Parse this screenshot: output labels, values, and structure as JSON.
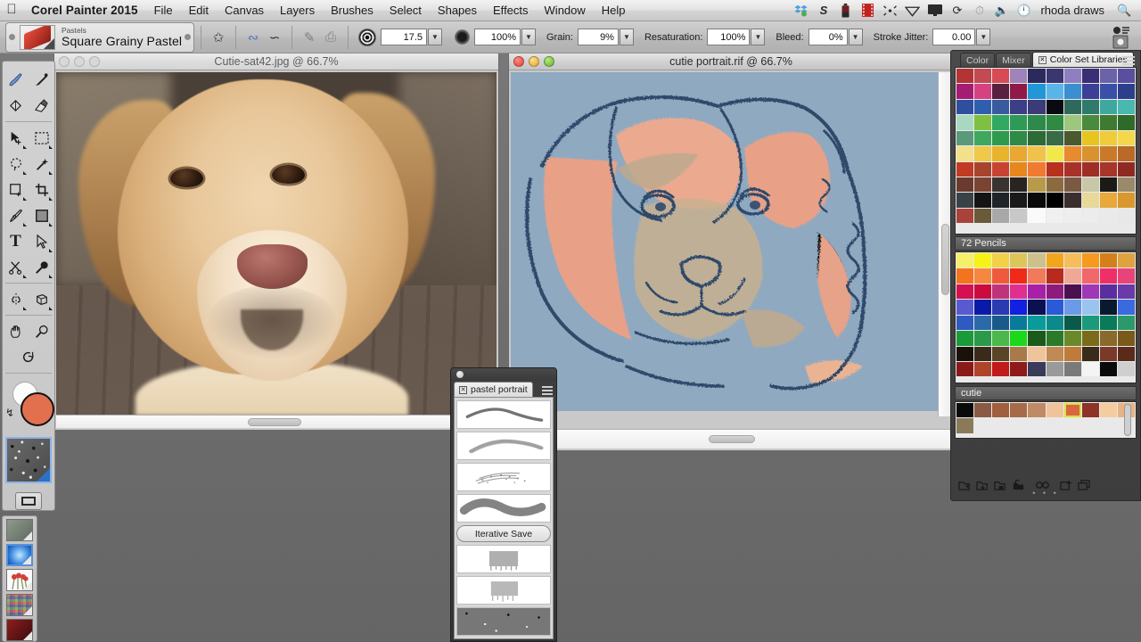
{
  "menubar": {
    "apple_icon": "apple-logo",
    "app_title": "Corel Painter 2015",
    "items": [
      "File",
      "Edit",
      "Canvas",
      "Layers",
      "Brushes",
      "Select",
      "Shapes",
      "Effects",
      "Window",
      "Help"
    ],
    "status_icons": [
      "dropbox-icon",
      "skitch-icon",
      "battery-icon",
      "screenflow-icon",
      "airplay-icon",
      "diamond-icon",
      "display-icon",
      "sync-icon",
      "timemachine-icon",
      "volume-icon",
      "clock-icon"
    ],
    "user_name": "rhoda draws",
    "search_icon": "search-icon"
  },
  "propbar": {
    "brush_category": "Pastels",
    "brush_name": "Square Grainy Pastel",
    "icons": [
      "brush-tracking-icon",
      "stroke-freehand-icon",
      "stroke-straight-icon",
      "brush-loading-icon",
      "brush-clone-icon"
    ],
    "size_icon": "brush-size-icon",
    "size_value": "17.5",
    "opacity_icon": "brush-opacity-icon",
    "opacity_value": "100%",
    "grain_label": "Grain:",
    "grain_value": "9%",
    "resaturation_label": "Resaturation:",
    "resaturation_value": "100%",
    "bleed_label": "Bleed:",
    "bleed_value": "0%",
    "jitter_label": "Stroke Jitter:",
    "jitter_value": "0.00",
    "right_icon": "brush-control-panel-icon"
  },
  "toolbox": {
    "tools": [
      {
        "name": "brush-tool",
        "glyph": "✎",
        "selected": true,
        "arrow": false
      },
      {
        "name": "dropper-tool",
        "glyph": "✒",
        "selected": false,
        "arrow": false
      },
      {
        "name": "paint-bucket-tool",
        "glyph": "◢",
        "selected": false,
        "arrow": false
      },
      {
        "name": "eraser-tool",
        "glyph": "▧",
        "selected": false,
        "arrow": false
      },
      {
        "name": "layer-adjuster-tool",
        "glyph": "➤",
        "selected": false,
        "arrow": true
      },
      {
        "name": "rectangular-selection-tool",
        "glyph": "⬚",
        "selected": false,
        "arrow": true
      },
      {
        "name": "lasso-tool",
        "glyph": "◌",
        "selected": false,
        "arrow": true
      },
      {
        "name": "magic-wand-tool",
        "glyph": "✦",
        "selected": false,
        "arrow": true
      },
      {
        "name": "crop-selection-tool",
        "glyph": "⬚",
        "selected": false,
        "arrow": true
      },
      {
        "name": "crop-tool",
        "glyph": "✛",
        "selected": false,
        "arrow": true
      },
      {
        "name": "pen-tool",
        "glyph": "✐",
        "selected": false,
        "arrow": true
      },
      {
        "name": "rectangular-shape-tool",
        "glyph": "■",
        "selected": false,
        "arrow": true
      },
      {
        "name": "text-tool",
        "glyph": "T",
        "selected": false,
        "arrow": false
      },
      {
        "name": "shape-selection-tool",
        "glyph": "➤",
        "selected": false,
        "arrow": true
      },
      {
        "name": "scissors-tool",
        "glyph": "✂",
        "selected": false,
        "arrow": true
      },
      {
        "name": "dropper-magnify-tool",
        "glyph": "⚲",
        "selected": false,
        "arrow": true
      },
      {
        "name": "mirror-painting-tool",
        "glyph": "⑂",
        "selected": false,
        "arrow": true
      },
      {
        "name": "perspective-grid-tool",
        "glyph": "▣",
        "selected": false,
        "arrow": true
      },
      {
        "name": "grabber-hand-tool",
        "glyph": "✋",
        "selected": false,
        "arrow": false
      },
      {
        "name": "magnifier-tool",
        "glyph": "⚲",
        "selected": false,
        "arrow": false
      },
      {
        "name": "rotate-page-tool",
        "glyph": "↻",
        "selected": false,
        "arrow": false
      }
    ],
    "paper_color": "#fdfdfd",
    "main_color": "#e2704f",
    "swap_icon": "swap-colors-icon",
    "paper_texture_name": "paper-texture-swatch",
    "screen_mode_icon": "screen-mode-icon"
  },
  "media_strip": {
    "items": [
      "paper-selector",
      "gradient-selector",
      "pattern-selector",
      "weave-selector",
      "nozzle-selector"
    ]
  },
  "documents": [
    {
      "id": "photo",
      "title": "Cutie-sat42.jpg @ 66.7%",
      "active": false,
      "traffic_lights": [
        "close-button",
        "minimize-button",
        "zoom-button"
      ],
      "zoom": "66.7%"
    },
    {
      "id": "painting",
      "title": "cutie portrait.rif @ 66.7%",
      "active": true,
      "traffic_lights": [
        "close-button",
        "minimize-button",
        "zoom-button"
      ],
      "zoom": "66.7%"
    }
  ],
  "float_palette": {
    "title": "pastel portrait",
    "close_icon": "close-icon",
    "menu_icon": "palette-menu-icon",
    "items": [
      {
        "name": "brush-stroke-thumbnail",
        "type": "stroke"
      },
      {
        "name": "brush-stroke-thumbnail",
        "type": "stroke"
      },
      {
        "name": "brush-stroke-thumbnail",
        "type": "stroke"
      },
      {
        "name": "brush-stroke-thumbnail",
        "type": "stroke"
      }
    ],
    "button_label": "Iterative Save",
    "items_after": [
      {
        "name": "brush-stroke-thumbnail",
        "type": "stroke"
      },
      {
        "name": "brush-stroke-thumbnail",
        "type": "stroke"
      },
      {
        "name": "paper-texture-thumbnail",
        "type": "grain"
      }
    ]
  },
  "color_panel": {
    "tabs": [
      {
        "label": "Color",
        "active": false,
        "closable": false
      },
      {
        "label": "Mixer",
        "active": false,
        "closable": false
      },
      {
        "label": "Color Set Libraries",
        "active": true,
        "closable": true
      }
    ],
    "menu_icon": "panel-menu-icon",
    "groups": [
      {
        "name": "painter-colors",
        "header": null,
        "columns": 10,
        "swatches": [
          "#b33434",
          "#c24a52",
          "#d84b54",
          "#9e84b8",
          "#2b2a5c",
          "#3b3570",
          "#8f7fc0",
          "#3a2f74",
          "#6b63a8",
          "#5a4e9e",
          "#a51d72",
          "#d6417f",
          "#5a2040",
          "#8e1a4a",
          "#2196d8",
          "#5ab4e8",
          "#3a8fd0",
          "#3c3f96",
          "#3a4fa8",
          "#2b3f8a",
          "#2f4f9e",
          "#2e5fae",
          "#3a5aa0",
          "#3a3f86",
          "#3c3a78",
          "#0a0a12",
          "#2e6a5c",
          "#2f7a6a",
          "#3ea8a0",
          "#49b8ae",
          "#a8d8c0",
          "#7ec042",
          "#32a862",
          "#2f9a58",
          "#2e8a4c",
          "#2f8a42",
          "#9ec77e",
          "#4a8a3e",
          "#3e7a32",
          "#2f6a2a",
          "#5a9a7a",
          "#3ea85e",
          "#2f9a4e",
          "#2e8a46",
          "#2c6a36",
          "#3a6a46",
          "#4a5a2e",
          "#e8c41e",
          "#f0cc3a",
          "#f5d84a",
          "#f2e08a",
          "#f0c84a",
          "#e8b42e",
          "#e8a832",
          "#f0c24a",
          "#f2e84a",
          "#e88a2e",
          "#d8922e",
          "#c87a2a",
          "#b86a26",
          "#c03a24",
          "#a8432e",
          "#c84432",
          "#e8861e",
          "#f07a32",
          "#b8301e",
          "#a8322a",
          "#9e2e26",
          "#a8352a",
          "#8e2a22",
          "#6a3a2e",
          "#7a4432",
          "#3a3430",
          "#2a2420",
          "#b89a4a",
          "#8a6a3e",
          "#7a5a42",
          "#c8c8a8",
          "#1a1a16",
          "#9a8a6a",
          "#3a4248",
          "#141414",
          "#1e2428",
          "#1a1a1a",
          "#0a0a0a",
          "#000000",
          "#3a2e2e",
          "#e8d89a",
          "#e8a83a",
          "#d8982e",
          "#a8423a",
          "#6a5a3a",
          "#a8a8a8",
          "#c8c8c8",
          "#fafafa",
          "#f0f0f0",
          "#eeeeee",
          "#ececec",
          "#eaeaea",
          "#e8e8e8"
        ]
      },
      {
        "name": "72-pencils",
        "header": "72 Pencils",
        "columns": 10,
        "swatches": [
          "#f5ef6a",
          "#f7f213",
          "#f2d047",
          "#ddc559",
          "#ccc18a",
          "#f3a51c",
          "#f5bd5b",
          "#f59a1c",
          "#d4801a",
          "#e0a23e",
          "#f4731e",
          "#f58840",
          "#f05a3c",
          "#ef2b18",
          "#f07a5a",
          "#b82a1e",
          "#f0a894",
          "#f0686a",
          "#ee2f6a",
          "#e8447a",
          "#d41050",
          "#cc0a3e",
          "#c0337a",
          "#e02f8e",
          "#a820a8",
          "#8e1a7e",
          "#4a1050",
          "#a037b8",
          "#5a2e9e",
          "#6a3aa8",
          "#5a5ad0",
          "#0a1aa8",
          "#2a3ab0",
          "#1220e0",
          "#0a1050",
          "#2a5ad8",
          "#6a9ae8",
          "#9ac4f0",
          "#0a1a2e",
          "#3a6ae0",
          "#2f5ac0",
          "#2a6aa8",
          "#1a5a8a",
          "#0a7a9a",
          "#0a9a9a",
          "#0a8a8a",
          "#0a5a4a",
          "#1a9a7a",
          "#0a7a5a",
          "#2a9a6a",
          "#1a9a3a",
          "#2a9a4a",
          "#4ab84a",
          "#1ad81a",
          "#1a5a1a",
          "#2a7a2a",
          "#6a8a2a",
          "#7a6a1a",
          "#8a6a2a",
          "#7a5a1a",
          "#1a120a",
          "#3a2a1a",
          "#5a4428",
          "#a87a4a",
          "#f0c49a",
          "#c08a52",
          "#c07a3a",
          "#3a2a18",
          "#7a3a2a",
          "#5a2a1a",
          "#8a1a1a",
          "#b0442a",
          "#c01a1a",
          "#8e1a1a",
          "#3a3a5a",
          "#9a9a9a",
          "#7a7a7a",
          "#f4f4f4",
          "#0a0a0a",
          "#cfcfcf"
        ]
      },
      {
        "name": "cutie",
        "header": "cutie",
        "columns": 10,
        "selected_index": 6,
        "swatches": [
          "#0a0a0a",
          "#8a5a44",
          "#a05f3f",
          "#a86b4a",
          "#c08a66",
          "#f0c49a",
          "#d9663f",
          "#8e3328",
          "#f5cc9e",
          "#e8b383",
          "#8a7a5a"
        ]
      }
    ],
    "footer_icons": [
      "new-color-set-icon",
      "import-color-set-icon",
      "save-color-set-icon",
      "color-set-options-icon",
      "find-color-icon",
      "add-color-icon",
      "delete-color-icon"
    ],
    "dots": "• • •"
  }
}
